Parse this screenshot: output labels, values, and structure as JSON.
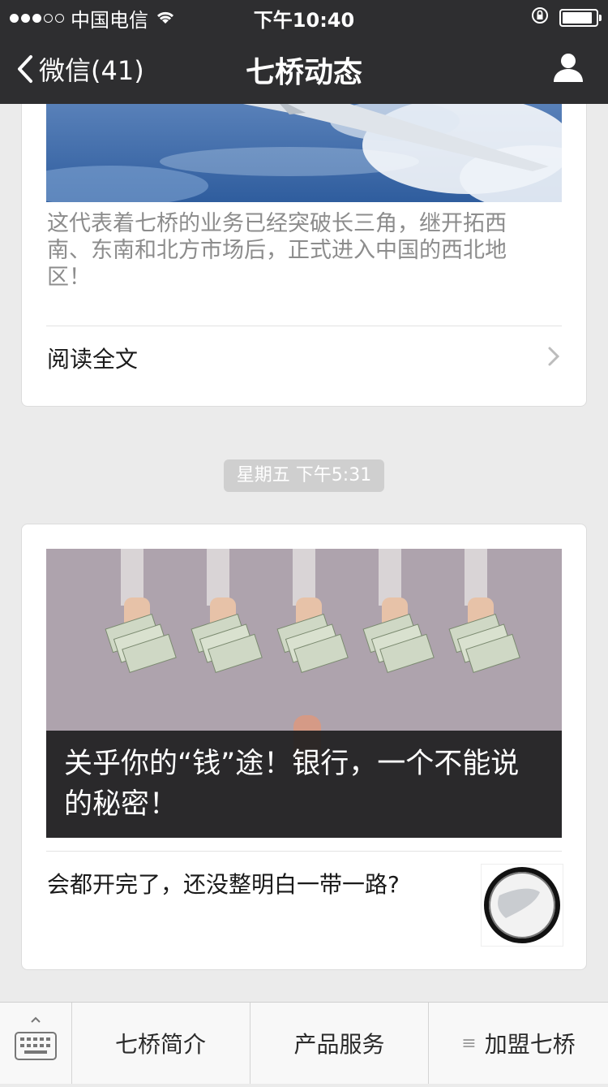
{
  "status_bar": {
    "carrier": "中国电信",
    "time": "下午10:40",
    "signal_dots_filled": 3,
    "signal_dots_total": 5,
    "icons": [
      "wifi-icon",
      "rotation-lock-icon",
      "battery-icon"
    ]
  },
  "nav": {
    "back_label": "微信(41)",
    "title": "七桥动态",
    "icons": [
      "back-chevron-icon",
      "profile-icon"
    ]
  },
  "article1": {
    "description": "这代表着七桥的业务已经突破长三角，继开拓西南、东南和北方市场后，正式进入中国的西北地区！",
    "read_more": "阅读全文"
  },
  "timestamp": "星期五 下午5:31",
  "article2": {
    "cover_title": "关乎你的“钱”途！银行，一个不能说的秘密！",
    "sub_title": "会都开完了，还没整明白一带一路?"
  },
  "tabbar": {
    "tabs": [
      "七桥简介",
      "产品服务",
      "加盟七桥"
    ],
    "icons": [
      "keyboard-icon",
      "menu-icon"
    ]
  },
  "colors": {
    "nav_bg": "#2e2e30",
    "page_bg": "#ebebeb",
    "card_bg": "#ffffff",
    "timestamp_bg": "#cfcfcf"
  }
}
